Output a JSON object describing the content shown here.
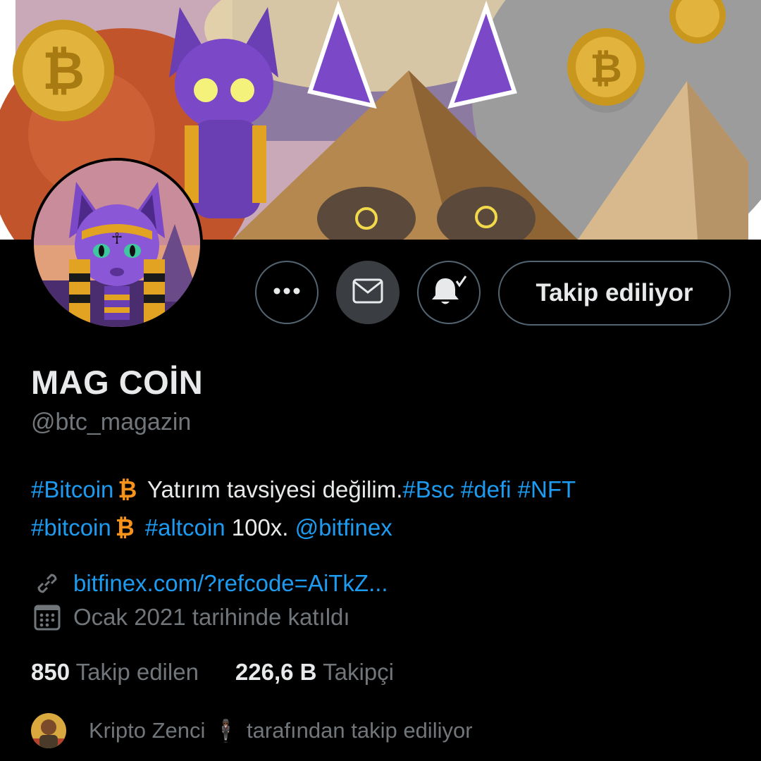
{
  "profile": {
    "name": "MAG COİN",
    "handle": "@btc_magazin",
    "bio": {
      "tag1": "#Bitcoin",
      "text1": "Yatırım tavsiyesi değilim.",
      "tag2": "#Bsc",
      "tag3": "#defi",
      "tag4": "#NFT",
      "tag5": "#bitcoin",
      "tag6": "#altcoin",
      "text2": "100x.",
      "mention": "@bitfinex",
      "emoji": "₿"
    },
    "website": "bitfinex.com/?refcode=AiTkZ...",
    "joined": "Ocak 2021 tarihinde katıldı"
  },
  "actions": {
    "follow_label": "Takip ediliyor"
  },
  "stats": {
    "following_count": "850",
    "following_label": "Takip edilen",
    "followers_count": "226,6 B",
    "followers_label": "Takipçi"
  },
  "followed_by": {
    "name": "Kripto Zenci",
    "emoji": "🕴🏾",
    "suffix": "tarafından takip ediliyor"
  },
  "colors": {
    "accent": "#1d9bf0",
    "background": "#000000",
    "muted": "#71767b",
    "bitcoin": "#f7931a"
  },
  "icons": [
    "more-icon",
    "mail-icon",
    "notification-bell-icon",
    "link-icon",
    "calendar-icon"
  ]
}
